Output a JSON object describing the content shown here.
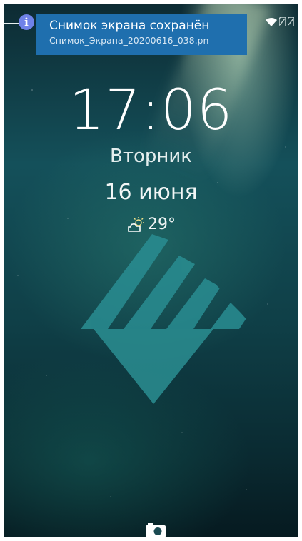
{
  "notification": {
    "title": "Снимок экрана сохранён",
    "subtitle": "Снимок_Экрана_20200616_038.pn",
    "color": "#1f6fae"
  },
  "status_bar": {
    "left_icon": "info-icon",
    "right_icons": [
      "wifi-icon",
      "sim-card-icon",
      "sim-card-icon"
    ]
  },
  "lockscreen": {
    "time": "17:06",
    "weekday": "Вторник",
    "date": "16 июня",
    "weather": {
      "icon": "partly-cloudy-icon",
      "temperature": "29°"
    },
    "logo": "sailfish-logo",
    "bottom_action": "camera-icon"
  },
  "colors": {
    "logo": "#2a8e92",
    "info_icon": "#6f82e8",
    "background": "#14505a"
  }
}
